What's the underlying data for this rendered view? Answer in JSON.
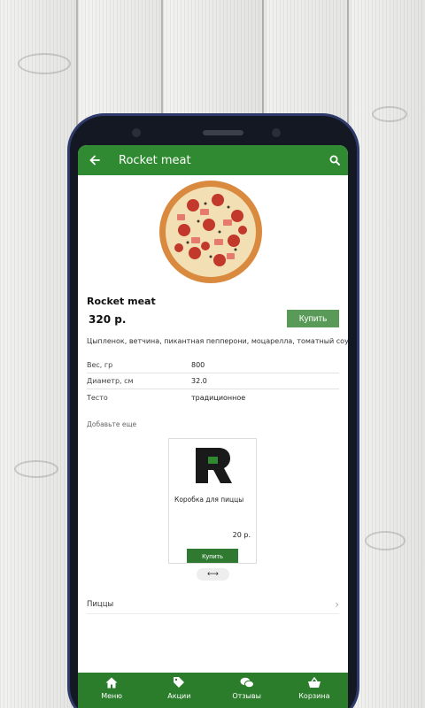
{
  "header": {
    "title": "Rocket meat"
  },
  "product": {
    "name": "Rocket meat",
    "price": "320 р.",
    "buy_label": "Купить",
    "description": "Цыпленок, ветчина, пикантная пепперони, моцарелла, томатный соус."
  },
  "specs": [
    {
      "label": "Вес, гр",
      "value": "800"
    },
    {
      "label": "Диаметр, см",
      "value": "32.0"
    },
    {
      "label": "Тесто",
      "value": "традиционное"
    }
  ],
  "addmore": {
    "title": "Добавьте еще",
    "item": {
      "name": "Коробка для пиццы",
      "price": "20 р.",
      "buy_label": "Купить"
    },
    "scroll_hint": "⟷"
  },
  "category": {
    "label": "Пиццы"
  },
  "bottom_nav": [
    {
      "label": "Меню",
      "icon": "home-icon"
    },
    {
      "label": "Акции",
      "icon": "tag-icon"
    },
    {
      "label": "Отзывы",
      "icon": "chat-icon"
    },
    {
      "label": "Корзина",
      "icon": "basket-icon"
    }
  ],
  "colors": {
    "primary": "#2f8a31",
    "button": "#5a9a59",
    "nav": "#2b7d2c"
  }
}
